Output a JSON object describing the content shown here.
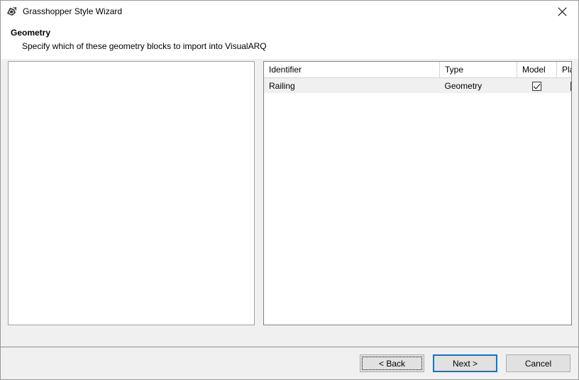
{
  "window": {
    "title": "Grasshopper Style Wizard",
    "icon": "grasshopper-icon",
    "close_icon": "close-icon"
  },
  "header": {
    "title": "Geometry",
    "subtitle": "Specify which of these geometry blocks to import into VisualARQ"
  },
  "left_panel": {
    "name": "preview-panel",
    "content": ""
  },
  "grid": {
    "columns": [
      {
        "key": "identifier",
        "label": "Identifier"
      },
      {
        "key": "type",
        "label": "Type"
      },
      {
        "key": "model",
        "label": "Model"
      },
      {
        "key": "plan",
        "label": "Plan"
      }
    ],
    "rows": [
      {
        "identifier": "Railing",
        "type": "Geometry",
        "model": true,
        "plan": false
      }
    ]
  },
  "footer": {
    "back_label": "< Back",
    "next_label": "Next >",
    "cancel_label": "Cancel"
  },
  "colors": {
    "accent": "#0078d7",
    "dialog_bg": "#f0f0f0",
    "button_bg": "#e1e1e1",
    "button_border": "#adadad",
    "panel_border": "#828282",
    "row_bg": "#f0f0f0"
  }
}
